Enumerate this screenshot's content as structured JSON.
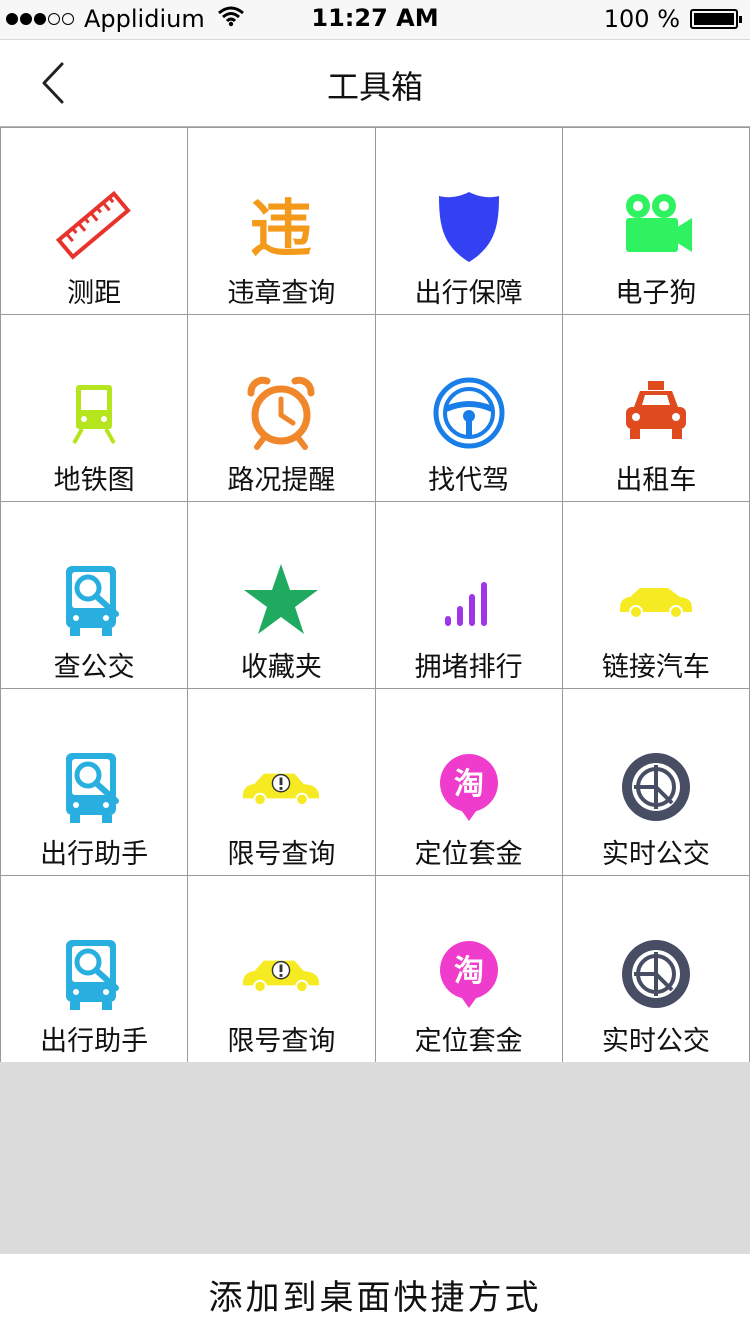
{
  "status_bar": {
    "carrier": "Applidium",
    "time": "11:27 AM",
    "battery": "100 %"
  },
  "nav": {
    "title": "工具箱",
    "back_icon": "chevron-left-icon"
  },
  "tools": [
    {
      "label": "测距",
      "icon": "ruler-icon",
      "color": "#e8332d"
    },
    {
      "label": "违章查询",
      "icon": "violation-icon",
      "color": "#f49a1a"
    },
    {
      "label": "出行保障",
      "icon": "shield-icon",
      "color": "#3441f2"
    },
    {
      "label": "电子狗",
      "icon": "video-camera-icon",
      "color": "#2ef25f"
    },
    {
      "label": "地铁图",
      "icon": "metro-icon",
      "color": "#b5e61d"
    },
    {
      "label": "路况提醒",
      "icon": "alarm-clock-icon",
      "color": "#f0872a"
    },
    {
      "label": "找代驾",
      "icon": "steering-wheel-icon",
      "color": "#1a7ee8"
    },
    {
      "label": "出租车",
      "icon": "taxi-icon",
      "color": "#e04a1f"
    },
    {
      "label": "查公交",
      "icon": "bus-search-icon",
      "color": "#29aee0"
    },
    {
      "label": "收藏夹",
      "icon": "star-icon",
      "color": "#1faa60"
    },
    {
      "label": "拥堵排行",
      "icon": "signal-bars-icon",
      "color": "#9e35e8"
    },
    {
      "label": "链接汽车",
      "icon": "car-icon",
      "color": "#f6eb23"
    },
    {
      "label": "出行助手",
      "icon": "bus-search-icon",
      "color": "#29aee0"
    },
    {
      "label": "限号查询",
      "icon": "car-alert-icon",
      "color": "#f6eb23"
    },
    {
      "label": "定位套金",
      "icon": "taobao-icon",
      "color": "#f03ccc",
      "glyph": "淘"
    },
    {
      "label": "实时公交",
      "icon": "wheel-icon",
      "color": "#474e63"
    },
    {
      "label": "出行助手",
      "icon": "bus-search-icon",
      "color": "#29aee0"
    },
    {
      "label": "限号查询",
      "icon": "car-alert-icon",
      "color": "#f6eb23"
    },
    {
      "label": "定位套金",
      "icon": "taobao-icon",
      "color": "#f03ccc",
      "glyph": "淘"
    },
    {
      "label": "实时公交",
      "icon": "wheel-icon",
      "color": "#474e63"
    }
  ],
  "bottom_action": "添加到桌面快捷方式"
}
